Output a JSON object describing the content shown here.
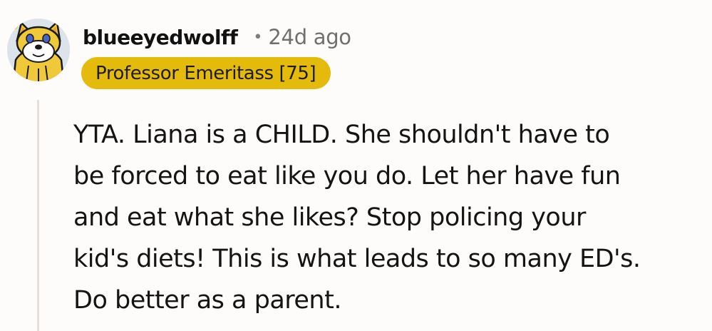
{
  "comment": {
    "avatar_icon": "shiba-doge-avatar-icon",
    "username": "blueeyedwolff",
    "separator": "•",
    "timestamp": "24d ago",
    "flair": {
      "text": "Professor Emeritass [75]",
      "background": "#e4ba0b"
    },
    "body_lines": [
      "YTA. Liana is a CHILD. She shouldn't have to",
      "be forced to eat like you do. Let her have fun",
      "and eat what she likes? Stop policing your",
      "kid's diets! This is what leads to so many ED's.",
      "Do better as a parent."
    ]
  },
  "colors": {
    "background": "#fdfcfb",
    "thread_line": "#e4dfdb",
    "meta_text": "#6f6f6f"
  }
}
